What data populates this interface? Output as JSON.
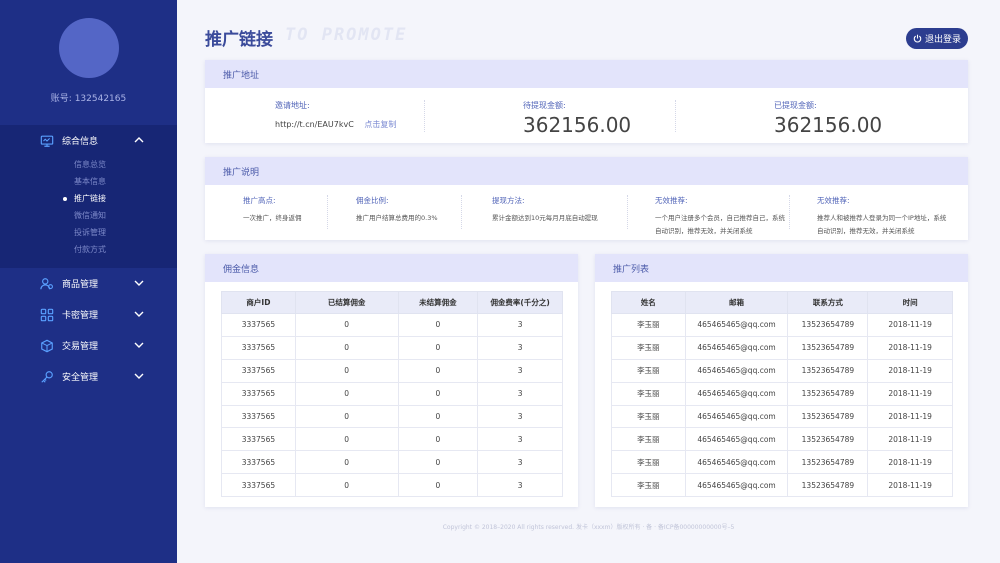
{
  "account": {
    "label": "账号:",
    "value": "132542165"
  },
  "menu": {
    "info": {
      "label": "综合信息",
      "icon": "monitor-icon",
      "submenu": [
        "信息总览",
        "基本信息",
        "推广链接",
        "微信通知",
        "投诉管理",
        "付款方式"
      ],
      "active": 2
    },
    "goods": {
      "label": "商品管理",
      "icon": "users-icon"
    },
    "card": {
      "label": "卡密管理",
      "icon": "grid-icon"
    },
    "trade": {
      "label": "交易管理",
      "icon": "cube-icon"
    },
    "security": {
      "label": "安全管理",
      "icon": "key-icon"
    }
  },
  "header": {
    "title": "推广链接",
    "subtitle": "TO PROMOTE",
    "logout_label": "退出登录"
  },
  "address": {
    "title": "推广地址",
    "invite_label": "邀请地址:",
    "invite_url": "http://t.cn/EAU7kvC",
    "copy_label": "点击复制",
    "pending_label": "待提现金额:",
    "pending_amount": "362156.00",
    "withdrawn_label": "已提现金额:",
    "withdrawn_amount": "362156.00"
  },
  "explain": {
    "title": "推广说明",
    "cols": [
      {
        "title": "推广高点:",
        "text": "一次推广，终身返佣"
      },
      {
        "title": "佣金比例:",
        "text": "推广用户结算总费用的0.3%"
      },
      {
        "title": "提现方法:",
        "text": "累计金额达到10元每月月底自动提现"
      },
      {
        "title": "无效推荐:",
        "text": "一个用户注册多个会员，自己推荐自己，系统自动识别，推荐无效，并关闭系统"
      },
      {
        "title": "无效推荐:",
        "text": "推荐人和被推荐人登录为同一个IP地址，系统自动识别，推荐无效，并关闭系统"
      }
    ]
  },
  "commission": {
    "title": "佣金信息",
    "headers": [
      "商户ID",
      "已结算佣金",
      "未结算佣金",
      "佣金费率(千分之)"
    ],
    "rows": [
      [
        "3337565",
        "0",
        "0",
        "3"
      ],
      [
        "3337565",
        "0",
        "0",
        "3"
      ],
      [
        "3337565",
        "0",
        "0",
        "3"
      ],
      [
        "3337565",
        "0",
        "0",
        "3"
      ],
      [
        "3337565",
        "0",
        "0",
        "3"
      ],
      [
        "3337565",
        "0",
        "0",
        "3"
      ],
      [
        "3337565",
        "0",
        "0",
        "3"
      ],
      [
        "3337565",
        "0",
        "0",
        "3"
      ]
    ]
  },
  "promote_list": {
    "title": "推广列表",
    "headers": [
      "姓名",
      "邮箱",
      "联系方式",
      "时间"
    ],
    "rows": [
      [
        "李玉丽",
        "465465465@qq.com",
        "13523654789",
        "2018-11-19"
      ],
      [
        "李玉丽",
        "465465465@qq.com",
        "13523654789",
        "2018-11-19"
      ],
      [
        "李玉丽",
        "465465465@qq.com",
        "13523654789",
        "2018-11-19"
      ],
      [
        "李玉丽",
        "465465465@qq.com",
        "13523654789",
        "2018-11-19"
      ],
      [
        "李玉丽",
        "465465465@qq.com",
        "13523654789",
        "2018-11-19"
      ],
      [
        "李玉丽",
        "465465465@qq.com",
        "13523654789",
        "2018-11-19"
      ],
      [
        "李玉丽",
        "465465465@qq.com",
        "13523654789",
        "2018-11-19"
      ],
      [
        "李玉丽",
        "465465465@qq.com",
        "13523654789",
        "2018-11-19"
      ]
    ]
  },
  "footer": "Copyright © 2018–2020 All rights reserved. 发卡（xxxm）版权所有 · 备 · 备ICP备00000000000号–5"
}
